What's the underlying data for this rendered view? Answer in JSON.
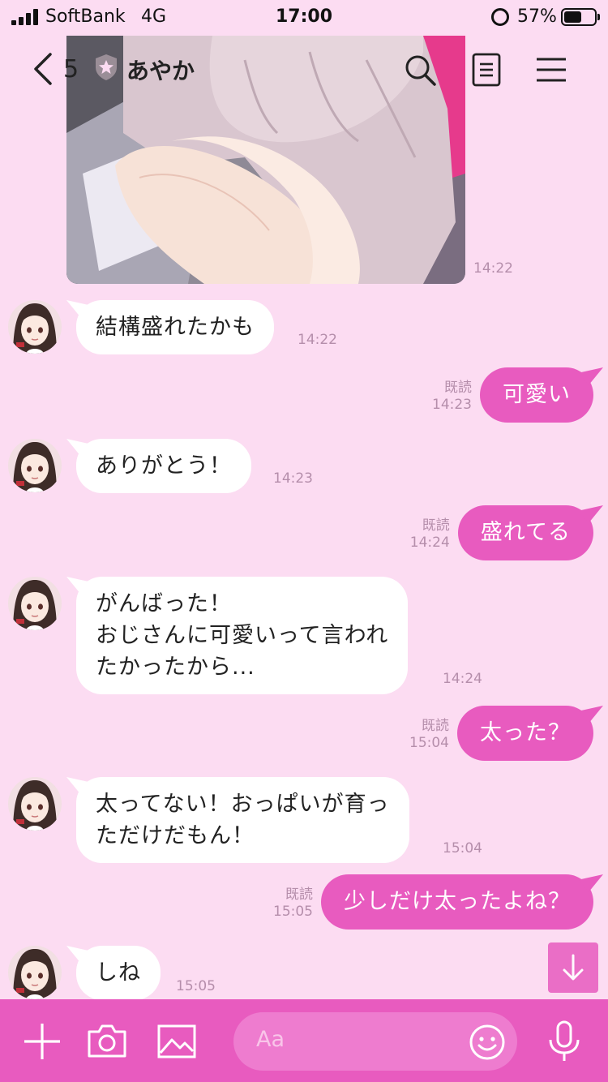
{
  "status_bar": {
    "carrier": "SoftBank",
    "network": "4G",
    "time": "17:00",
    "battery_percent": "57%",
    "battery_level": 0.57
  },
  "header": {
    "back_count": "5",
    "title": "あやか",
    "icons": [
      "back-chevron-icon",
      "official-badge-icon",
      "search-icon",
      "notes-icon",
      "menu-icon"
    ]
  },
  "photo_message": {
    "time": "14:22"
  },
  "messages": [
    {
      "side": "in",
      "lines": [
        "結構盛れたかも"
      ],
      "time": "14:22"
    },
    {
      "side": "out",
      "lines": [
        "可愛い"
      ],
      "read": "既読",
      "time": "14:23"
    },
    {
      "side": "in",
      "lines": [
        "ありがとう！"
      ],
      "time": "14:23"
    },
    {
      "side": "out",
      "lines": [
        "盛れてる"
      ],
      "read": "既読",
      "time": "14:24"
    },
    {
      "side": "in",
      "lines": [
        "がんばった！",
        "おじさんに可愛いって言われ",
        "たかったから..."
      ],
      "time": "14:24"
    },
    {
      "side": "out",
      "lines": [
        "太った？"
      ],
      "read": "既読",
      "time": "15:04"
    },
    {
      "side": "in",
      "lines": [
        "太ってない！おっぱいが育っ",
        "ただけだもん！"
      ],
      "time": "15:04"
    },
    {
      "side": "out",
      "lines": [
        "少しだけ太ったよね？"
      ],
      "read": "既読",
      "time": "15:05"
    },
    {
      "side": "in",
      "lines": [
        "しね"
      ],
      "time": "15:05"
    }
  ],
  "input": {
    "placeholder": "Aa",
    "icons": [
      "plus-icon",
      "camera-icon",
      "image-icon",
      "emoji-icon",
      "microphone-icon"
    ]
  },
  "colors": {
    "background": "#fcdcf2",
    "accent": "#e85bbf",
    "incoming_bubble": "#ffffff",
    "meta_text": "#b58eab"
  }
}
